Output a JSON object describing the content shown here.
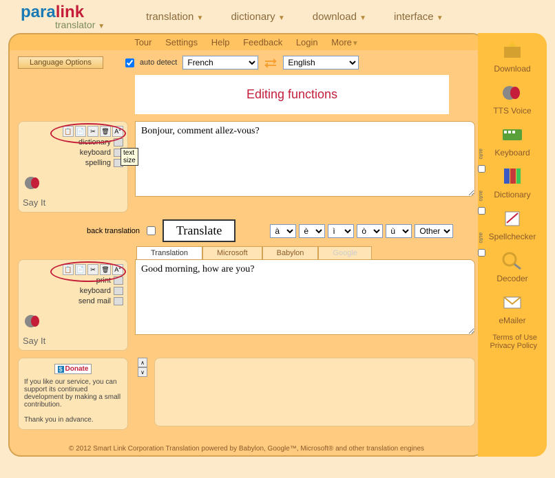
{
  "logo": {
    "para": "para",
    "link": "link",
    "sub": "translator"
  },
  "nav": {
    "items": [
      {
        "label": "translation"
      },
      {
        "label": "dictionary"
      },
      {
        "label": "download"
      },
      {
        "label": "interface"
      }
    ]
  },
  "top_menu": {
    "items": [
      "Tour",
      "Settings",
      "Help",
      "Feedback",
      "Login",
      "More"
    ]
  },
  "controls": {
    "lang_options": "Language Options",
    "auto_detect": "auto detect",
    "auto_detect_checked": true,
    "from_lang": "French",
    "to_lang": "English"
  },
  "editing_banner": "Editing functions",
  "source": {
    "text": "Bonjour, comment allez-vous?",
    "links": {
      "dictionary": "dictionary",
      "keyboard": "keyboard",
      "spelling": "spelling"
    },
    "sayit": "Say It",
    "tooltip": "text size"
  },
  "mid": {
    "back_translation": "back translation",
    "translate": "Translate",
    "accents": [
      "à",
      "è",
      "ì",
      "ò",
      "ù"
    ],
    "other": "Other"
  },
  "tabs": {
    "items": [
      {
        "label": "Translation",
        "active": true
      },
      {
        "label": "Microsoft"
      },
      {
        "label": "Babylon"
      },
      {
        "label": "Google",
        "faded": true
      }
    ]
  },
  "target": {
    "text": "Good morning, how are you?",
    "links": {
      "print": "print",
      "keyboard": "keyboard",
      "sendmail": "send mail"
    },
    "sayit": "Say It"
  },
  "donate": {
    "dollar": "$",
    "label": "Donate",
    "body": "If you like our service, you can support its continued development by making a small contribution.",
    "thanks": "Thank you in advance."
  },
  "right": {
    "items": [
      {
        "label": "Download"
      },
      {
        "label": "TTS Voice"
      },
      {
        "label": "Keyboard"
      },
      {
        "label": "Dictionary"
      },
      {
        "label": "Spellchecker"
      },
      {
        "label": "Decoder"
      },
      {
        "label": "eMailer"
      }
    ],
    "auto_labels": [
      "auto",
      "auto",
      "auto"
    ]
  },
  "footer": {
    "copyright": "© 2012 Smart Link Corporation   Translation powered by Babylon, Google™, Microsoft® and other translation engines",
    "terms": "Terms of Use",
    "privacy": "Privacy Policy"
  }
}
